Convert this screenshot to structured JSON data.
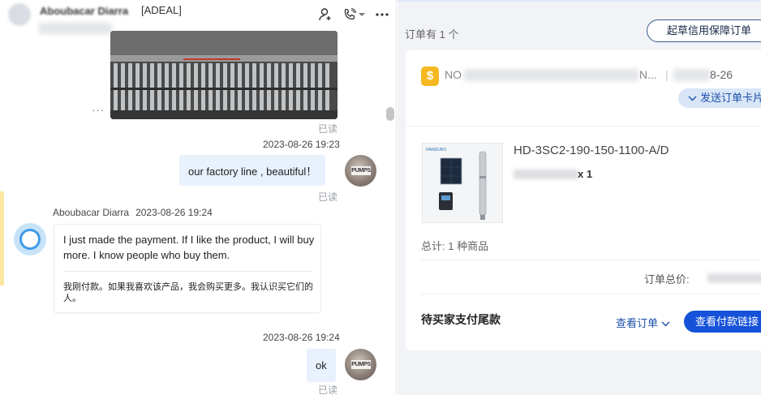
{
  "chat": {
    "header": {
      "contact_name": "Aboubacar Diarra",
      "contact_tag": "[ADEAL]",
      "icons": [
        "add-contact-icon",
        "phone-icon",
        "chevron-down-icon",
        "more-icon"
      ]
    },
    "image_message": {
      "more_label": "···",
      "read_label": "已读"
    },
    "messages": [
      {
        "timestamp": "2023-08-26 19:23",
        "text": "our factory line , beautiful！",
        "read_label": "已读"
      },
      {
        "sender": "Aboubacar Diarra",
        "timestamp": "2023-08-26 19:24",
        "text": "I just made the payment. If I like the product, I will buy more. I know people who buy them.",
        "translation": "我刚付款。如果我喜欢该产品，我会购买更多。我认识买它们的人。"
      },
      {
        "timestamp": "2023-08-26 19:24",
        "text": "ok",
        "read_label": "已读"
      }
    ],
    "avatar_logo_text": "PUMPS"
  },
  "orders": {
    "count_label": "订单有 1 个",
    "draft_button": "起草信用保障订单",
    "order": {
      "number_prefix": "NO",
      "number_suffix": "N...",
      "date_suffix": "8-26",
      "send_card_button": "发送订单卡片",
      "product_name": "HD-3SC2-190-150-1100-A/D",
      "product_qty": "x 1",
      "product_image_brand": "HANDURO",
      "total_items": "总计: 1 种商品",
      "total_price_label": "订单总价:",
      "status": "待买家支付尾款",
      "view_order": "查看订单",
      "pay_link_button": "查看付款链接"
    }
  }
}
